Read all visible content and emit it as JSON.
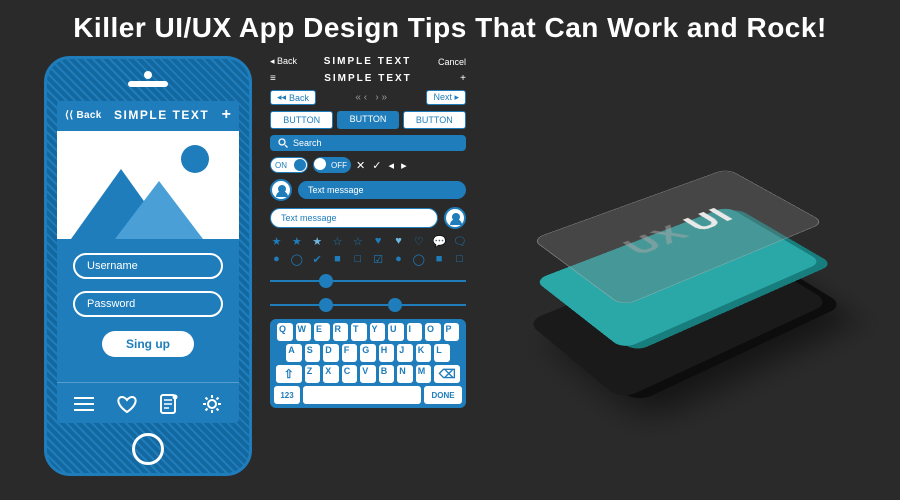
{
  "title": "Killer UI/UX App Design Tips That Can Work and Rock!",
  "phone": {
    "back": "⟨⟨ Back",
    "title": "SIMPLE TEXT",
    "plus": "+",
    "username": "Username",
    "password": "Password",
    "signup": "Sing up"
  },
  "kit": {
    "row1": {
      "back": "◂ Back",
      "title": "SIMPLE TEXT",
      "cancel": "Cancel"
    },
    "row2": {
      "menu": "≡",
      "title": "SIMPLE TEXT",
      "plus": "+"
    },
    "row3": {
      "back": "Back",
      "next": "Next ▸"
    },
    "buttons": [
      "BUTTON",
      "BUTTON",
      "BUTTON"
    ],
    "search": "Search",
    "toggle_on": "ON",
    "toggle_off": "OFF",
    "marks": "✕ ✓ ◂ ▸",
    "msg1": "Text message",
    "msg2": "Text message",
    "keyboard": {
      "r1": [
        "Q",
        "W",
        "E",
        "R",
        "T",
        "Y",
        "U",
        "I",
        "O",
        "P"
      ],
      "r2": [
        "A",
        "S",
        "D",
        "F",
        "G",
        "H",
        "J",
        "K",
        "L"
      ],
      "r3_shift": "⇧",
      "r3": [
        "Z",
        "X",
        "C",
        "V",
        "B",
        "N",
        "M"
      ],
      "r3_del": "⌫",
      "r4_num": "123",
      "r4_done": "DONE"
    }
  },
  "iso": {
    "ux": "UX",
    "ui": "UI"
  }
}
